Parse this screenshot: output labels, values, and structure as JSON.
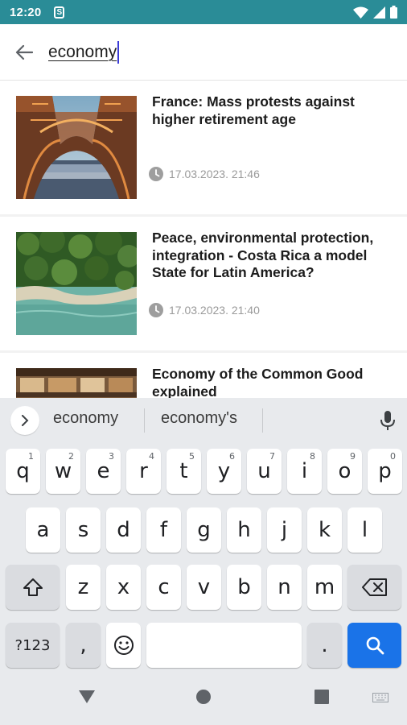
{
  "status_bar": {
    "time": "12:20",
    "sim_icon": "S"
  },
  "search": {
    "query": "economy"
  },
  "articles": [
    {
      "title": "France: Mass protests against higher retirement age",
      "datetime": "17.03.2023. 21:46",
      "image": "eiffel-tower-photo"
    },
    {
      "title": "Peace, environmental protection, integration - Costa Rica a model State for Latin America?",
      "datetime": "17.03.2023. 21:40",
      "image": "coastline-aerial-photo"
    },
    {
      "title": "Economy of the Common Good explained",
      "datetime": "",
      "image": "market-stall-photo"
    }
  ],
  "keyboard": {
    "suggestions": [
      "economy",
      "economy's"
    ],
    "row1": [
      {
        "key": "q",
        "hint": "1"
      },
      {
        "key": "w",
        "hint": "2"
      },
      {
        "key": "e",
        "hint": "3"
      },
      {
        "key": "r",
        "hint": "4"
      },
      {
        "key": "t",
        "hint": "5"
      },
      {
        "key": "y",
        "hint": "6"
      },
      {
        "key": "u",
        "hint": "7"
      },
      {
        "key": "i",
        "hint": "8"
      },
      {
        "key": "o",
        "hint": "9"
      },
      {
        "key": "p",
        "hint": "0"
      }
    ],
    "row2": [
      "a",
      "s",
      "d",
      "f",
      "g",
      "h",
      "j",
      "k",
      "l"
    ],
    "row3": [
      "z",
      "x",
      "c",
      "v",
      "b",
      "n",
      "m"
    ],
    "symbols_label": "?123",
    "comma": ",",
    "period": ".",
    "icons": {
      "shift": "shift-icon",
      "backspace": "backspace-icon",
      "emoji": "emoji-icon",
      "search": "search-icon",
      "mic": "microphone-icon"
    },
    "colors": {
      "enter": "#1a73e8",
      "keyboard_bg": "#e8eaed"
    }
  },
  "colors": {
    "status_bar": "#2a8c97",
    "caret": "#3b3bd8"
  }
}
